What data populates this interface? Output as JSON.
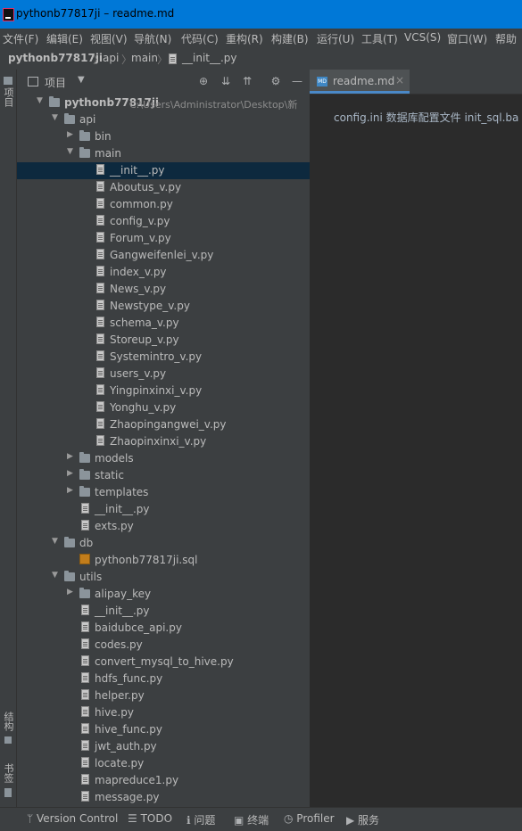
{
  "window": {
    "title": "pythonb77817ji – readme.md"
  },
  "menu": [
    "文件(F)",
    "编辑(E)",
    "视图(V)",
    "导航(N)",
    "代码(C)",
    "重构(R)",
    "构建(B)",
    "运行(U)",
    "工具(T)",
    "VCS(S)",
    "窗口(W)",
    "帮助"
  ],
  "breadcrumb": [
    "pythonb77817ji",
    "api",
    "main",
    "__init__.py"
  ],
  "left_strip": {
    "top": "项目",
    "structure": "结构",
    "bookmarks": "书签"
  },
  "project_panel": {
    "title": "项目"
  },
  "tree": [
    {
      "label": "pythonb77817ji",
      "path": "C:\\Users\\Administrator\\Desktop\\新",
      "kind": "root",
      "expanded": true
    },
    {
      "label": "api",
      "kind": "folder",
      "expanded": true
    },
    {
      "label": "bin",
      "kind": "folder",
      "expanded": false
    },
    {
      "label": "main",
      "kind": "folder",
      "expanded": true
    },
    {
      "label": "__init__.py",
      "kind": "file",
      "selected": true
    },
    {
      "label": "Aboutus_v.py",
      "kind": "file"
    },
    {
      "label": "common.py",
      "kind": "file"
    },
    {
      "label": "config_v.py",
      "kind": "file"
    },
    {
      "label": "Forum_v.py",
      "kind": "file"
    },
    {
      "label": "Gangweifenlei_v.py",
      "kind": "file"
    },
    {
      "label": "index_v.py",
      "kind": "file"
    },
    {
      "label": "News_v.py",
      "kind": "file"
    },
    {
      "label": "Newstype_v.py",
      "kind": "file"
    },
    {
      "label": "schema_v.py",
      "kind": "file"
    },
    {
      "label": "Storeup_v.py",
      "kind": "file"
    },
    {
      "label": "Systemintro_v.py",
      "kind": "file"
    },
    {
      "label": "users_v.py",
      "kind": "file"
    },
    {
      "label": "Yingpinxinxi_v.py",
      "kind": "file"
    },
    {
      "label": "Yonghu_v.py",
      "kind": "file"
    },
    {
      "label": "Zhaopingangwei_v.py",
      "kind": "file"
    },
    {
      "label": "Zhaopinxinxi_v.py",
      "kind": "file"
    },
    {
      "label": "models",
      "kind": "folder",
      "expanded": false
    },
    {
      "label": "static",
      "kind": "folder",
      "expanded": false
    },
    {
      "label": "templates",
      "kind": "folder",
      "expanded": false
    },
    {
      "label": "__init__.py",
      "kind": "file"
    },
    {
      "label": "exts.py",
      "kind": "file"
    },
    {
      "label": "db",
      "kind": "folder",
      "expanded": true
    },
    {
      "label": "pythonb77817ji.sql",
      "kind": "sql"
    },
    {
      "label": "utils",
      "kind": "folder",
      "expanded": true
    },
    {
      "label": "alipay_key",
      "kind": "folder",
      "expanded": false
    },
    {
      "label": "__init__.py",
      "kind": "file"
    },
    {
      "label": "baidubce_api.py",
      "kind": "file"
    },
    {
      "label": "codes.py",
      "kind": "file"
    },
    {
      "label": "convert_mysql_to_hive.py",
      "kind": "file"
    },
    {
      "label": "hdfs_func.py",
      "kind": "file"
    },
    {
      "label": "helper.py",
      "kind": "file"
    },
    {
      "label": "hive.py",
      "kind": "file"
    },
    {
      "label": "hive_func.py",
      "kind": "file"
    },
    {
      "label": "jwt_auth.py",
      "kind": "file"
    },
    {
      "label": "locate.py",
      "kind": "file"
    },
    {
      "label": "mapreduce1.py",
      "kind": "file"
    },
    {
      "label": "message.py",
      "kind": "file"
    }
  ],
  "editor": {
    "tab_label": "readme.md",
    "content": "config.ini 数据库配置文件 init_sql.ba"
  },
  "statusbar": [
    "Version Control",
    "TODO",
    "问题",
    "终端",
    "Profiler",
    "服务"
  ],
  "colors": {
    "accent": "#0078d7",
    "selection": "#0d293e",
    "panel": "#3c3f41",
    "editor_bg": "#2b2b2b"
  }
}
